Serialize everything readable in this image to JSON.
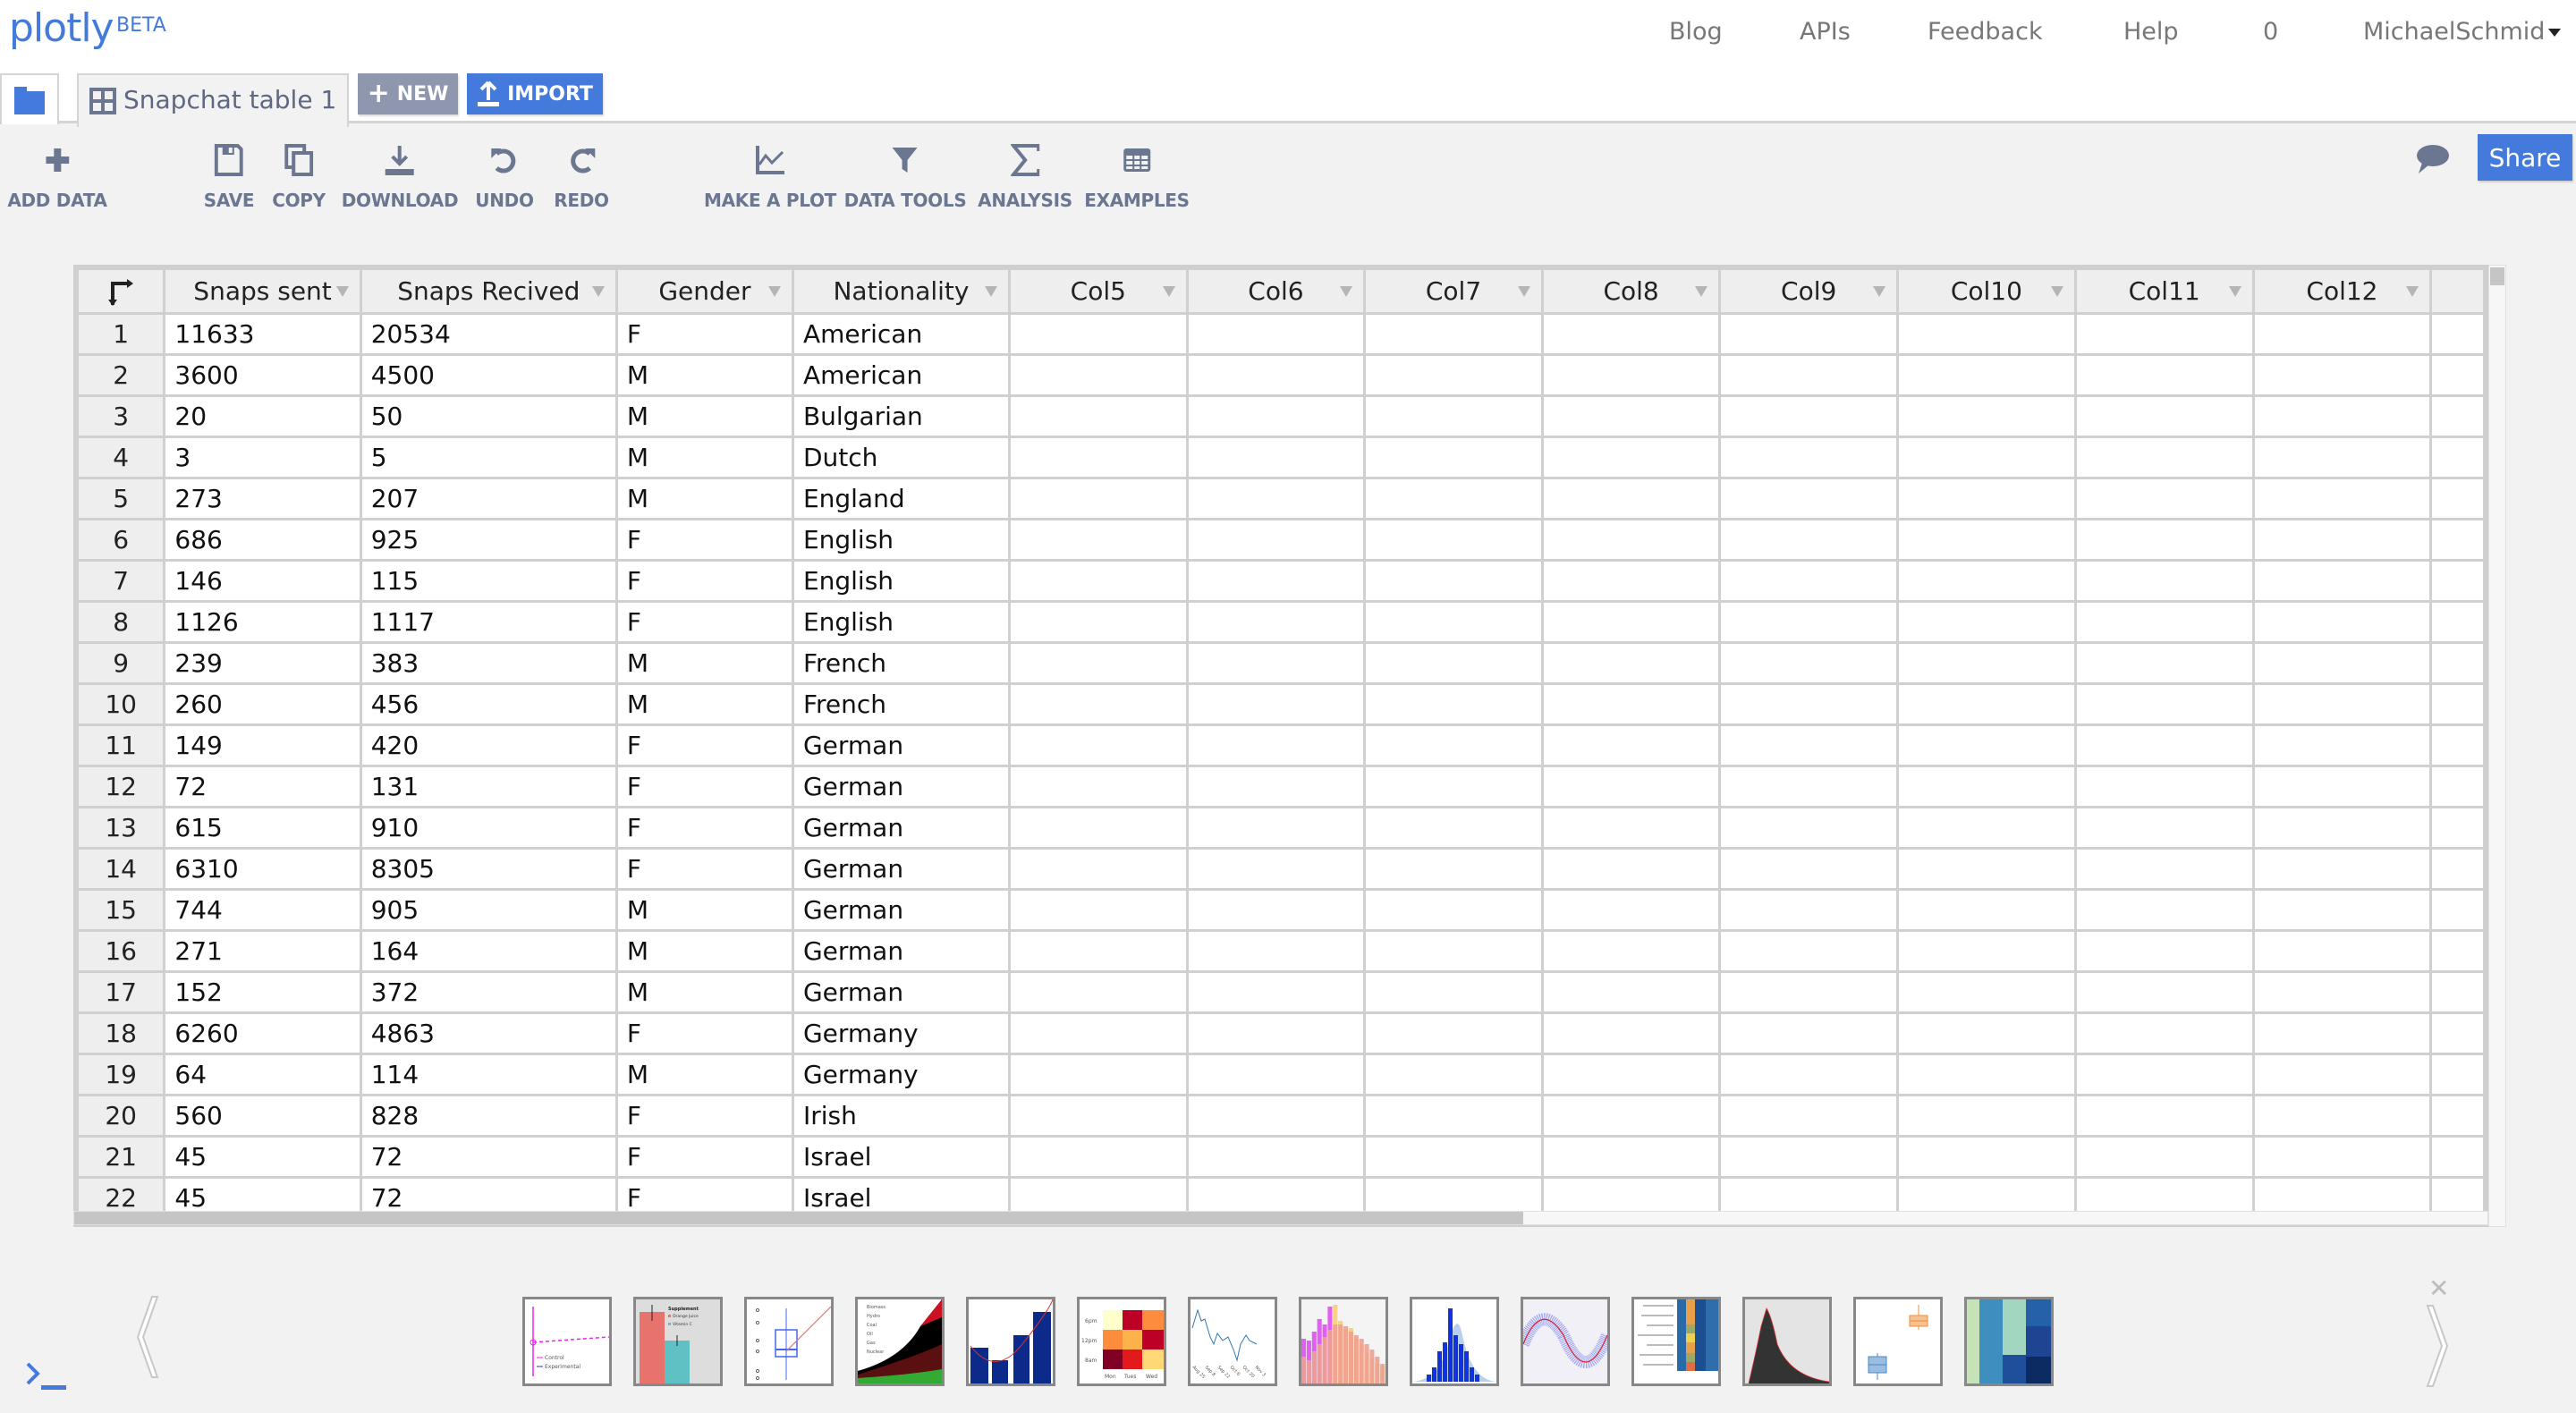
{
  "header": {
    "logo": "plotly",
    "beta": "BETA",
    "nav": [
      {
        "label": "Blog"
      },
      {
        "label": "APIs"
      },
      {
        "label": "Feedback"
      },
      {
        "label": "Help"
      },
      {
        "label": "0"
      },
      {
        "label": "MichaelSchmid"
      }
    ]
  },
  "tabs": {
    "active_tab": "Snapchat table 1",
    "new_label": "NEW",
    "import_label": "IMPORT"
  },
  "toolbar": {
    "add_data": "ADD DATA",
    "save": "SAVE",
    "copy": "COPY",
    "download": "DOWNLOAD",
    "undo": "UNDO",
    "redo": "REDO",
    "make_plot": "MAKE A PLOT",
    "data_tools": "DATA TOOLS",
    "analysis": "ANALYSIS",
    "examples": "EXAMPLES",
    "share": "Share"
  },
  "grid": {
    "columns": [
      "Snaps sent",
      "Snaps Recived",
      "Gender",
      "Nationality",
      "Col5",
      "Col6",
      "Col7",
      "Col8",
      "Col9",
      "Col10",
      "Col11",
      "Col12"
    ],
    "rows": [
      [
        "1",
        "11633",
        "20534",
        "F",
        "American"
      ],
      [
        "2",
        "3600",
        "4500",
        "M",
        "American"
      ],
      [
        "3",
        "20",
        "50",
        "M",
        "Bulgarian"
      ],
      [
        "4",
        "3",
        "5",
        "M",
        "Dutch"
      ],
      [
        "5",
        "273",
        "207",
        "M",
        "England"
      ],
      [
        "6",
        "686",
        "925",
        "F",
        "English"
      ],
      [
        "7",
        "146",
        "115",
        "F",
        "English"
      ],
      [
        "8",
        "1126",
        "1117",
        "F",
        "English"
      ],
      [
        "9",
        "239",
        "383",
        "M",
        "French"
      ],
      [
        "10",
        "260",
        "456",
        "M",
        "French"
      ],
      [
        "11",
        "149",
        "420",
        "F",
        "German"
      ],
      [
        "12",
        "72",
        "131",
        "F",
        "German"
      ],
      [
        "13",
        "615",
        "910",
        "F",
        "German"
      ],
      [
        "14",
        "6310",
        "8305",
        "F",
        "German"
      ],
      [
        "15",
        "744",
        "905",
        "M",
        "German"
      ],
      [
        "16",
        "271",
        "164",
        "M",
        "German"
      ],
      [
        "17",
        "152",
        "372",
        "M",
        "German"
      ],
      [
        "18",
        "6260",
        "4863",
        "F",
        "Germany"
      ],
      [
        "19",
        "64",
        "114",
        "M",
        "Germany"
      ],
      [
        "20",
        "560",
        "828",
        "F",
        "Irish"
      ],
      [
        "21",
        "45",
        "72",
        "F",
        "Israel"
      ],
      [
        "22",
        "45",
        "72",
        "F",
        "Israel"
      ]
    ]
  },
  "examples_strip": {
    "thumbnails": [
      {
        "name": "error-bars-line",
        "legend": [
          "Control",
          "Experimental"
        ]
      },
      {
        "name": "bar-error-bars",
        "legend_title": "Supplement",
        "legend": [
          "Orange Juice",
          "Vitamin C"
        ]
      },
      {
        "name": "box-scatter"
      },
      {
        "name": "stacked-area",
        "legend": [
          "Biomass",
          "Hydro",
          "Coal",
          "Oil",
          "Gas",
          "Nuclear"
        ]
      },
      {
        "name": "bar-line-fit"
      },
      {
        "name": "heatmap-days",
        "y_labels": [
          "6pm",
          "12pm",
          "8am"
        ],
        "x_labels": [
          "Mon",
          "Tues",
          "Wed"
        ]
      },
      {
        "name": "time-series",
        "x_labels": [
          "Aug 25",
          "Sep 8",
          "Sep 22",
          "Oct 6",
          "Oct 20",
          "Nov 3"
        ]
      },
      {
        "name": "overlaid-histogram"
      },
      {
        "name": "histogram-density"
      },
      {
        "name": "sine-scatter"
      },
      {
        "name": "heatmap-names"
      },
      {
        "name": "density-histogram"
      },
      {
        "name": "box-plots"
      },
      {
        "name": "heatmap-blue"
      }
    ]
  }
}
